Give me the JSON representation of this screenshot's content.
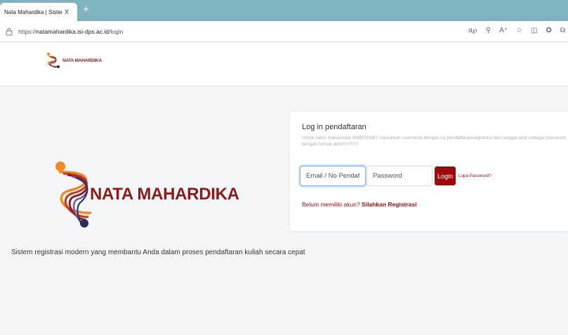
{
  "browser": {
    "tab_title": "Nata Mahardika | Sistem Manaj",
    "tab_close": "X",
    "new_tab": "+",
    "url_prefix": "https://",
    "url_domain": "natamahardika.isi-dps.ac.id",
    "url_path": "/login",
    "icons": [
      "read-aloud-icon",
      "zoom-icon",
      "text-size-icon",
      "favorite-icon",
      "split-screen-icon",
      "favorites-icon",
      "collections-icon"
    ]
  },
  "header": {
    "logo_text": "NATA MAHARDIKA"
  },
  "hero": {
    "brand_text": "NATA MAHARDIKA",
    "tagline": "Sistem registrasi modern yang membantu Anda dalam proses pendaftaran kuliah secara cepat"
  },
  "login": {
    "title": "Log in pendaftaran",
    "description": "Untuk calon mahasiswa SNBP/SNBT masukkan username dengan no pendaftaran/registrasi dan tanggal lahir sebagai password dengan format ddmmYYYY",
    "email_placeholder": "Email / No Pendaftaran",
    "password_placeholder": "Password",
    "login_label": "Login",
    "forgot_label": "Lupa Password?",
    "register_prompt": "Belum memiliki akun?",
    "register_link": "Silahkan Registrasi"
  },
  "colors": {
    "brand": "#8b1a1a",
    "button": "#9b0d0d",
    "tabbar": "#7fb3bd",
    "logo_orange": "#f08a24",
    "logo_navy": "#2b2d5c"
  }
}
